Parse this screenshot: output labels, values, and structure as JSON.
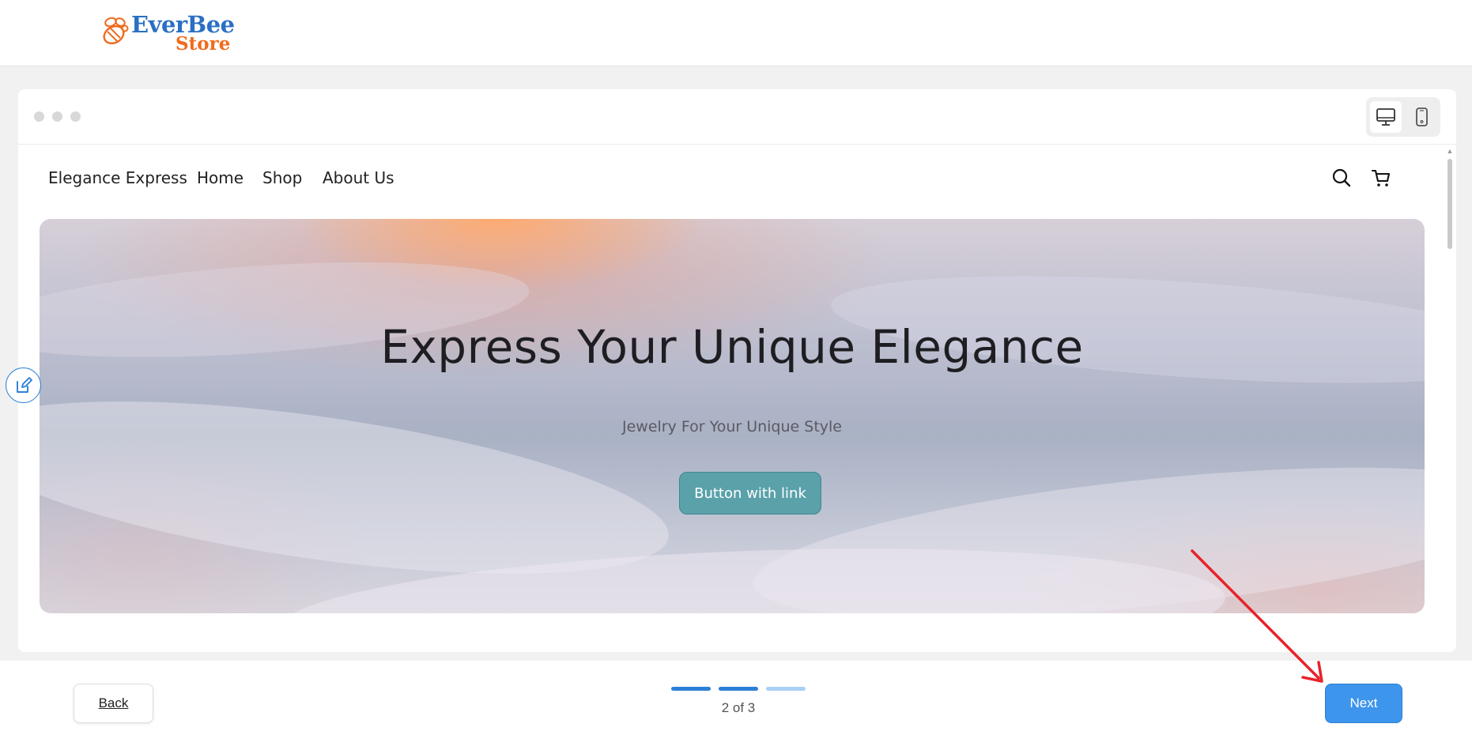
{
  "header": {
    "logo_word1": "EverBee",
    "logo_word2": "Store",
    "logo_color_primary": "#2a6fc4",
    "logo_color_accent": "#f06b1d"
  },
  "preview": {
    "window_dots": 3,
    "device_toggle": {
      "options": [
        "desktop-icon",
        "mobile-icon"
      ],
      "selected": "desktop"
    },
    "site": {
      "brand": "Elegance Express",
      "nav": [
        "Home",
        "Shop",
        "About Us"
      ],
      "icons": [
        "search-icon",
        "cart-icon"
      ],
      "hero": {
        "title": "Express Your Unique Elegance",
        "subtitle": "Jewelry For Your Unique Style",
        "button_label": "Button with link",
        "button_color": "#5aa1aa"
      }
    },
    "edit_icon": "edit-icon"
  },
  "footer": {
    "back_label": "Back",
    "next_label": "Next",
    "step_text": "2 of 3",
    "progress": {
      "current": 2,
      "total": 3
    },
    "accent": "#3d95ec"
  }
}
